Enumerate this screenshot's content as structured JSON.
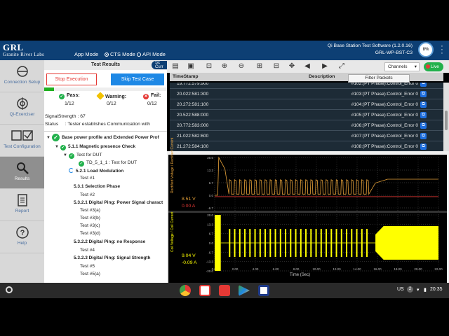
{
  "header": {
    "logo_mark": "GRL",
    "logo_sub": "Granite River Labs",
    "app_mode_label": "App Mode",
    "modes": [
      "CTS Mode",
      "API Mode"
    ],
    "selected_mode": "CTS Mode",
    "title": "Qi Base Station Test Software (1.2.0.16)",
    "device": "GRL-WP-BST-C3",
    "gauge": "8%"
  },
  "sidebar": {
    "items": [
      {
        "label": "Connection Setup",
        "icon": "connection-icon"
      },
      {
        "label": "Qi-Exerciser",
        "icon": "target-icon"
      },
      {
        "label": "Test Configuration",
        "icon": "checkbox-list-icon"
      },
      {
        "label": "Results",
        "icon": "results-icon",
        "active": true
      },
      {
        "label": "Report",
        "icon": "report-icon"
      },
      {
        "label": "Help",
        "icon": "help-icon"
      }
    ]
  },
  "results": {
    "title": "Test Results",
    "scurr": "Sc Curr",
    "stop_label": "Stop Execution",
    "skip_label": "Skip Test Case",
    "progress": 0.08,
    "pass_label": "Pass:",
    "pass_value": "1/12",
    "warning_label": "Warning:",
    "warning_value": "0/12",
    "fail_label": "Fail:",
    "fail_value": "0/12",
    "signal": "SignalStrength : 67",
    "status_label": "Status",
    "status_text": ":   Tester establishes Communication with"
  },
  "tree": [
    {
      "text": "Base power profile and Extended Power Prof",
      "bold": true
    },
    {
      "text": "5.1.1 Magnetic presence Check",
      "bold": true
    },
    {
      "text": "Test for DUT",
      "bold": false
    },
    {
      "text": "TD_5_1_1 : Test for DUT",
      "bold": false
    },
    {
      "text": "5.2.1 Load Modulation",
      "bold": true
    },
    {
      "text": "Test #1",
      "bold": false
    },
    {
      "text": "5.3.1 Selection Phase",
      "bold": true
    },
    {
      "text": "Test #2",
      "bold": false
    },
    {
      "text": "5.3.2.1 Digital Ping: Power Signal charact",
      "bold": true
    },
    {
      "text": "Test #3(a)",
      "bold": false
    },
    {
      "text": "Test #3(b)",
      "bold": false
    },
    {
      "text": "Test #3(c)",
      "bold": false
    },
    {
      "text": "Test #3(d)",
      "bold": false
    },
    {
      "text": "5.3.2.2 Digital Ping: no Response",
      "bold": true
    },
    {
      "text": "Test #4",
      "bold": false
    },
    {
      "text": "5.3.2.3 Digital Ping: Signal Strength",
      "bold": true
    },
    {
      "text": "Test #5",
      "bold": false
    },
    {
      "text": "Test #5(a)",
      "bold": false
    }
  ],
  "toolbar": {
    "channels_label": "Channels",
    "live_label": "Live"
  },
  "packets": {
    "col_timestamp": "TimeStamp",
    "col_description": "Description",
    "filter_label": "Filter Packets",
    "rows": [
      {
        "time": "19.772:579:900",
        "desc": "#102:(PT Phase):Control_Error 0"
      },
      {
        "time": "20.022:581:300",
        "desc": "#103:(PT Phase):Control_Error 0"
      },
      {
        "time": "20.272:581:100",
        "desc": "#104:(PT Phase):Control_Error 0"
      },
      {
        "time": "20.522:588:000",
        "desc": "#105:(PT Phase):Control_Error 0"
      },
      {
        "time": "20.772:583:000",
        "desc": "#106:(PT Phase):Control_Error 0"
      },
      {
        "time": "21.022:582:600",
        "desc": "#107:(PT Phase):Control_Error 0"
      },
      {
        "time": "21.272:584:100",
        "desc": "#108:(PT Phase):Control_Error 0"
      }
    ]
  },
  "scope": {
    "top_channel": "Rectified Voltage / Rectified Current",
    "top_voltage": "8.51 V",
    "top_current": "0.00 A",
    "top_ticks": [
      "20.0",
      "13.3",
      "6.7",
      "0.0",
      "-6.7"
    ],
    "bottom_channel": "Coil Voltage / Coil Current",
    "bottom_voltage": "9.04 V",
    "bottom_current": "-0.09 A",
    "bottom_ticks": [
      "20.0",
      "13.3",
      "6.7",
      "0.0",
      "-6.7",
      "-13.3",
      "-20.0"
    ],
    "x_ticks": [
      "0.00",
      "2.00",
      "4.00",
      "6.00",
      "8.00",
      "10.00",
      "12.00",
      "14.00",
      "16.00",
      "18.00",
      "20.00",
      "22.00"
    ],
    "x_label": "Time (Sec)",
    "colors": {
      "voltage": "#e8a33a",
      "current": "#e53935",
      "coil": "#ffff00"
    }
  },
  "taskbar": {
    "locale": "US",
    "badge": "2",
    "time": "20:35"
  }
}
